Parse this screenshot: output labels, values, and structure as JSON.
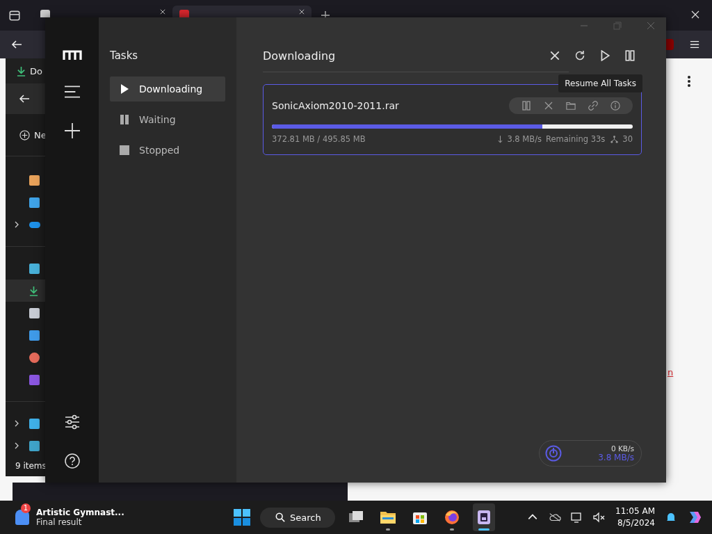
{
  "browser": {
    "tabs": [
      {
        "kind": "motrix",
        "selected": false
      },
      {
        "kind": "mega",
        "selected": true
      }
    ],
    "page_link": "n"
  },
  "explorer": {
    "title": "Do",
    "new_button": "Ne",
    "status": "9 items"
  },
  "motrix": {
    "panel_title": "Tasks",
    "categories": [
      {
        "label": "Downloading",
        "kind": "downloading",
        "selected": true
      },
      {
        "label": "Waiting",
        "kind": "waiting",
        "selected": false
      },
      {
        "label": "Stopped",
        "kind": "stopped",
        "selected": false
      }
    ],
    "list_title": "Downloading",
    "tooltip": "Resume All Tasks",
    "tasks": [
      {
        "name": "SonicAxiom2010-2011.rar",
        "level": 0.75,
        "progress": "372.81 MB / 495.85 MB",
        "speed": "3.8 MB/s",
        "remaining": "Remaining 33s",
        "connections": "30"
      }
    ],
    "speedometer": {
      "upload": "0 KB/s",
      "download": "3.8 MB/s"
    }
  },
  "taskbar": {
    "notification": {
      "title": "Artistic Gymnast...",
      "subtitle": "Final result",
      "badge": "1"
    },
    "search": "Search",
    "apps": [
      {
        "kind": "taskview",
        "running": false,
        "selected": false
      },
      {
        "kind": "files",
        "running": true,
        "selected": false
      },
      {
        "kind": "store",
        "running": false,
        "selected": false
      },
      {
        "kind": "firefox",
        "running": true,
        "selected": false
      },
      {
        "kind": "motrix",
        "running": true,
        "selected": true
      }
    ],
    "time": "11:05 AM",
    "date": "8/5/2024"
  }
}
